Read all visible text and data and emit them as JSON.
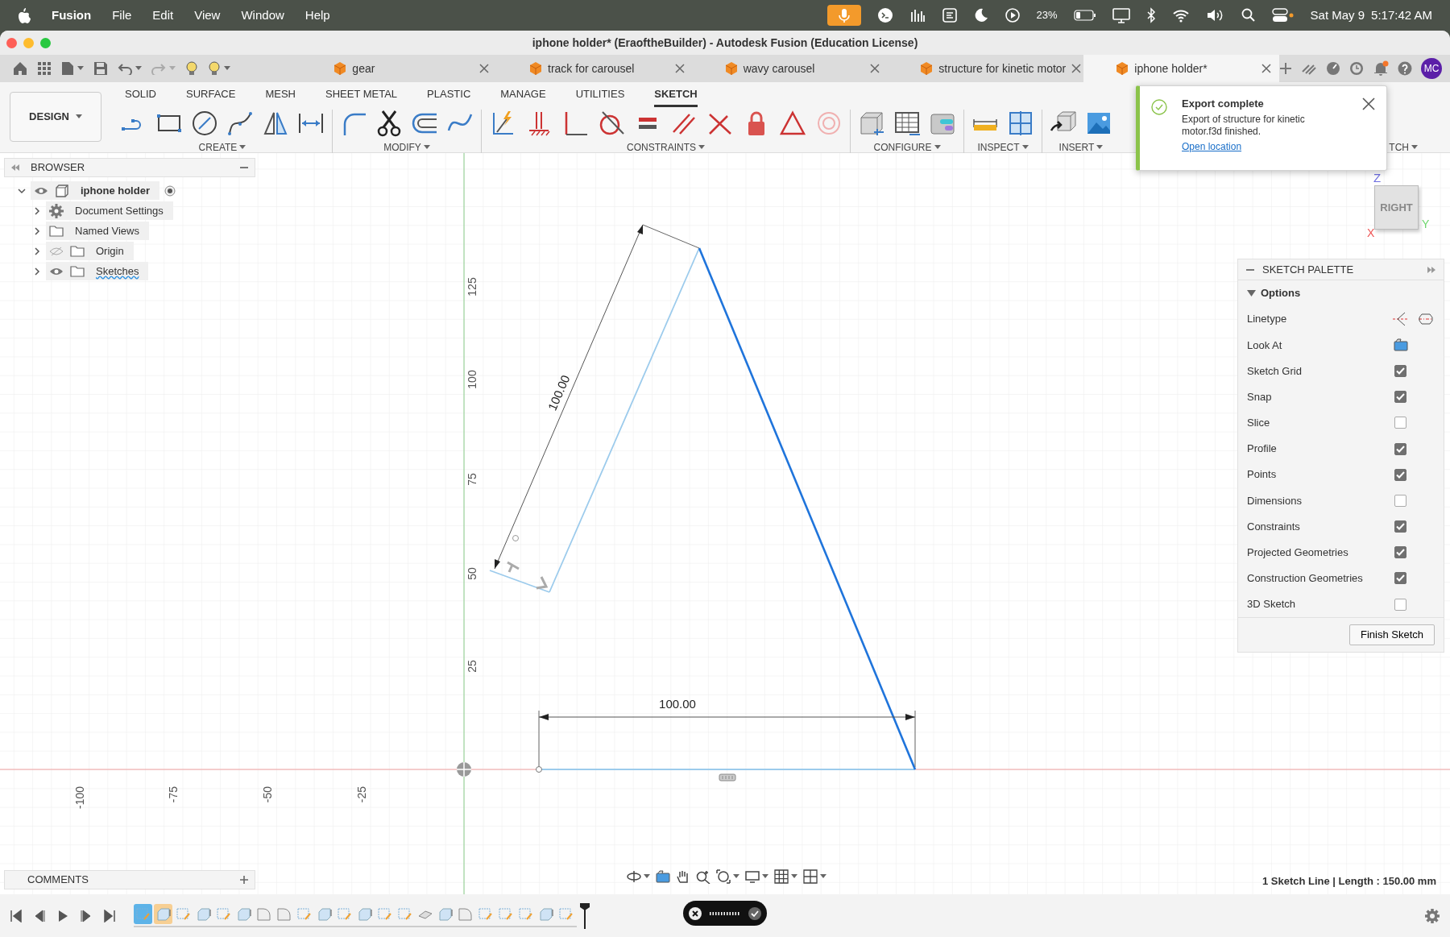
{
  "menu_bar": {
    "app": "Fusion",
    "items": [
      "File",
      "Edit",
      "View",
      "Window",
      "Help"
    ],
    "battery": "23%",
    "date": "Sat May 9",
    "time": "5:17:42 AM"
  },
  "window": {
    "title": "iphone holder* (EraoftheBuilder) - Autodesk Fusion (Education License)"
  },
  "doc_tabs": [
    {
      "label": "gear",
      "selected": false
    },
    {
      "label": "track for carousel",
      "selected": false
    },
    {
      "label": "wavy carousel",
      "selected": false
    },
    {
      "label": "structure for kinetic motor",
      "selected": false
    },
    {
      "label": "iphone holder*",
      "selected": true
    }
  ],
  "user": {
    "initials": "MC"
  },
  "workspace": {
    "label": "DESIGN"
  },
  "toolbar_tabs": [
    {
      "label": "SOLID",
      "selected": false
    },
    {
      "label": "SURFACE",
      "selected": false
    },
    {
      "label": "MESH",
      "selected": false
    },
    {
      "label": "SHEET METAL",
      "selected": false
    },
    {
      "label": "PLASTIC",
      "selected": false
    },
    {
      "label": "MANAGE",
      "selected": false
    },
    {
      "label": "UTILITIES",
      "selected": false
    },
    {
      "label": "SKETCH",
      "selected": true
    }
  ],
  "tool_groups": [
    {
      "label": "CREATE"
    },
    {
      "label": "MODIFY"
    },
    {
      "label": "CONSTRAINTS"
    },
    {
      "label": "CONFIGURE"
    },
    {
      "label": "INSPECT"
    },
    {
      "label": "INSERT"
    },
    {
      "label": "TCH"
    }
  ],
  "toast": {
    "title": "Export complete",
    "message": "Export of structure for kinetic motor.f3d finished.",
    "link": "Open location"
  },
  "browser": {
    "title": "BROWSER",
    "tree": [
      {
        "label": "iphone holder",
        "kind": "component",
        "expanded": true,
        "visible": true,
        "warning": false,
        "children": [
          {
            "label": "Document Settings",
            "kind": "settings",
            "expanded": false,
            "warning": false
          },
          {
            "label": "Named Views",
            "kind": "folder",
            "expanded": false,
            "warning": false
          },
          {
            "label": "Origin",
            "kind": "folder",
            "expanded": false,
            "visible": false,
            "warning": false
          },
          {
            "label": "Sketches",
            "kind": "folder",
            "expanded": false,
            "visible": true,
            "warning": true
          }
        ]
      }
    ]
  },
  "view_cube": {
    "face": "RIGHT",
    "z": "Z",
    "y": "Y",
    "x": "X"
  },
  "canvas": {
    "x_axis_labels": [
      "-100",
      "-75",
      "-50",
      "-25"
    ],
    "y_axis_labels": [
      "125",
      "100",
      "75",
      "50",
      "25"
    ],
    "aligned_dimension": "100.00",
    "horizontal_dimension": "100.00"
  },
  "sketch_palette": {
    "title": "SKETCH PALETTE",
    "section": "Options",
    "rows": [
      {
        "label": "Linetype",
        "kind": "linetype"
      },
      {
        "label": "Look At",
        "kind": "look_at"
      },
      {
        "label": "Sketch Grid",
        "kind": "checkbox",
        "checked": true
      },
      {
        "label": "Snap",
        "kind": "checkbox",
        "checked": true
      },
      {
        "label": "Slice",
        "kind": "checkbox",
        "checked": false
      },
      {
        "label": "Profile",
        "kind": "checkbox",
        "checked": true
      },
      {
        "label": "Points",
        "kind": "checkbox",
        "checked": true
      },
      {
        "label": "Dimensions",
        "kind": "checkbox",
        "checked": false
      },
      {
        "label": "Constraints",
        "kind": "checkbox",
        "checked": true
      },
      {
        "label": "Projected Geometries",
        "kind": "checkbox",
        "checked": true
      },
      {
        "label": "Construction Geometries",
        "kind": "checkbox",
        "checked": true
      },
      {
        "label": "3D Sketch",
        "kind": "checkbox",
        "checked": false
      }
    ],
    "finish_button": "Finish Sketch"
  },
  "comments": {
    "title": "COMMENTS"
  },
  "status": "1 Sketch Line | Length : 150.00 mm",
  "timeline": {
    "items": [
      {
        "kind": "sketch",
        "selected": true,
        "highlighted": false
      },
      {
        "kind": "extrude",
        "selected": false,
        "highlighted": true
      },
      {
        "kind": "sketch",
        "selected": false,
        "highlighted": false
      },
      {
        "kind": "extrude",
        "selected": false,
        "highlighted": false
      },
      {
        "kind": "sketch",
        "selected": false,
        "highlighted": false
      },
      {
        "kind": "extrude",
        "selected": false,
        "highlighted": false
      },
      {
        "kind": "fillet",
        "selected": false,
        "highlighted": false
      },
      {
        "kind": "fillet",
        "selected": false,
        "highlighted": false
      },
      {
        "kind": "sketch",
        "selected": false,
        "highlighted": false
      },
      {
        "kind": "extrude",
        "selected": false,
        "highlighted": false
      },
      {
        "kind": "sketch",
        "selected": false,
        "highlighted": false
      },
      {
        "kind": "extrude",
        "selected": false,
        "highlighted": false
      },
      {
        "kind": "sketch",
        "selected": false,
        "highlighted": false
      },
      {
        "kind": "sketch",
        "selected": false,
        "highlighted": false
      },
      {
        "kind": "chamfer",
        "selected": false,
        "highlighted": false
      },
      {
        "kind": "extrude",
        "selected": false,
        "highlighted": false
      },
      {
        "kind": "fillet",
        "selected": false,
        "highlighted": false
      },
      {
        "kind": "sketch",
        "selected": false,
        "highlighted": false
      },
      {
        "kind": "sketch",
        "selected": false,
        "highlighted": false
      },
      {
        "kind": "sketch",
        "selected": false,
        "highlighted": false
      },
      {
        "kind": "extrude",
        "selected": false,
        "highlighted": false
      },
      {
        "kind": "sketch",
        "selected": false,
        "highlighted": false
      }
    ]
  }
}
